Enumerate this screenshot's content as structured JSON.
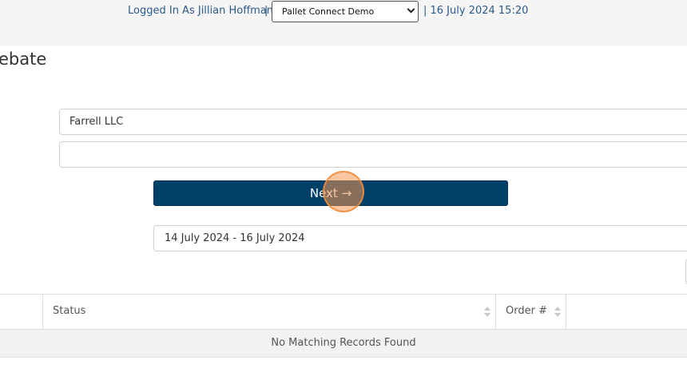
{
  "header": {
    "logged_in_text": "Logged In As Jillian Hoffman",
    "separator": "|",
    "organization_selected": "Pallet Connect Demo",
    "datetime": "| 16 July 2024 15:20"
  },
  "page": {
    "title": "ebate"
  },
  "form": {
    "customer_value": "Farrell LLC",
    "second_value": "",
    "next_label": "Next →",
    "date_range_value": "14 July 2024 - 16 July 2024"
  },
  "table": {
    "columns": [
      "",
      "Status",
      "Order #",
      ""
    ],
    "empty_message": "No Matching Records Found"
  },
  "colors": {
    "primary_button": "#00416a",
    "link_text": "#2b5a8a",
    "click_highlight": "#f59650"
  }
}
